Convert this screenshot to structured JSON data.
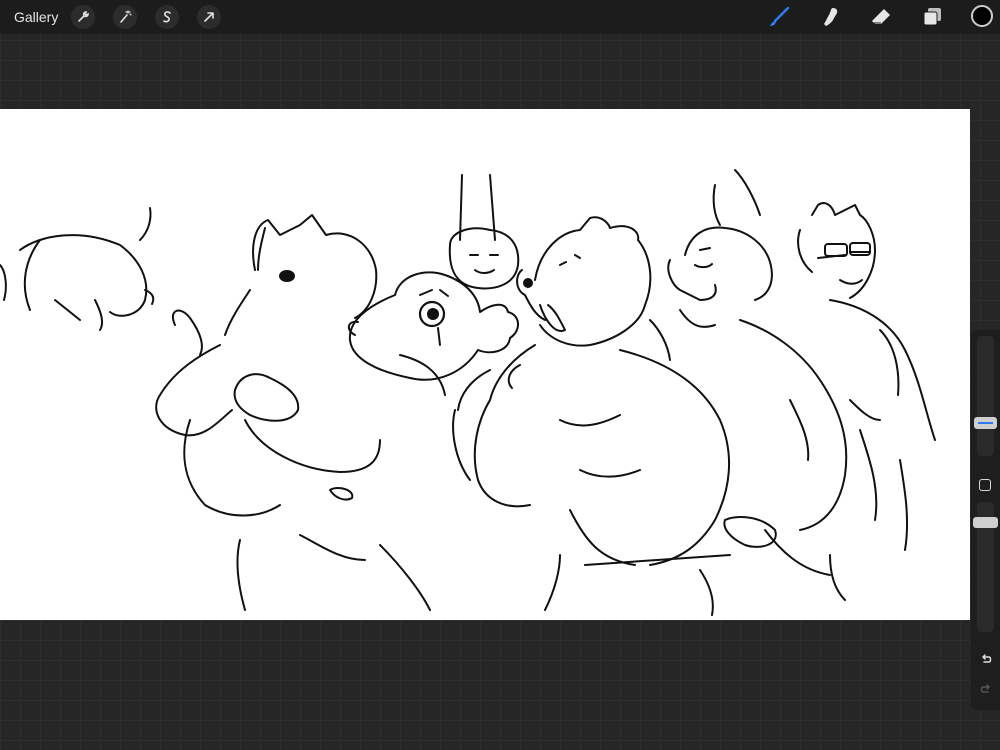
{
  "topbar": {
    "gallery_label": "Gallery",
    "left_tools": [
      {
        "name": "actions",
        "icon": "wrench-icon"
      },
      {
        "name": "adjustments",
        "icon": "magic-wand-icon"
      },
      {
        "name": "selection",
        "icon": "selection-s-icon"
      },
      {
        "name": "transform",
        "icon": "arrow-cursor-icon"
      }
    ],
    "right_tools": [
      {
        "name": "brush",
        "icon": "brush-icon",
        "active": true
      },
      {
        "name": "smudge",
        "icon": "smudge-finger-icon"
      },
      {
        "name": "eraser",
        "icon": "eraser-icon"
      },
      {
        "name": "layers",
        "icon": "layers-icon"
      }
    ],
    "current_color": "#000000",
    "accent_color": "#2d7cf6"
  },
  "sidebar": {
    "controls": [
      "brush-size-slider",
      "modify-button",
      "opacity-slider",
      "undo-icon",
      "redo-icon"
    ]
  }
}
